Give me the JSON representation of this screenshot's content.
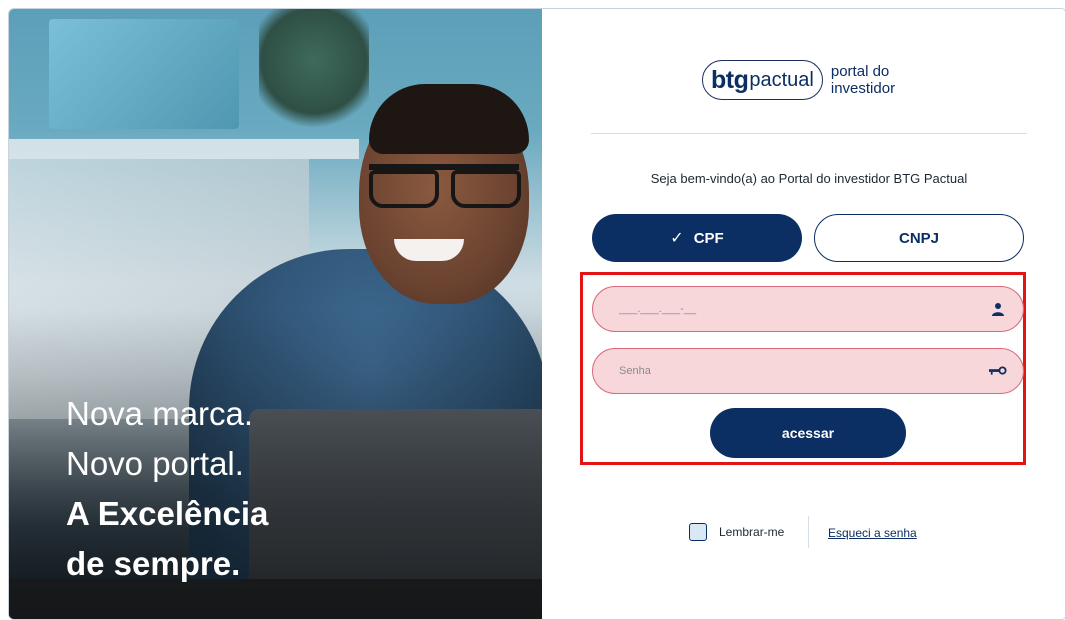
{
  "hero": {
    "tagline_line1": "Nova marca.",
    "tagline_line2": "Novo portal.",
    "tagline_line3": "A Excelência",
    "tagline_line4": "de sempre."
  },
  "logo": {
    "brand": "btg",
    "brand_suffix": "pactual",
    "subtitle_line1": "portal do",
    "subtitle_line2": "investidor"
  },
  "welcome_text": "Seja bem-vindo(a) ao Portal do investidor BTG Pactual",
  "doc_type_toggle": {
    "options": [
      "CPF",
      "CNPJ"
    ],
    "selected": "CPF",
    "check_glyph": "✓"
  },
  "login_form": {
    "cpf_placeholder": "___.___.___-__",
    "cpf_value": "",
    "password_placeholder": "Senha",
    "password_value": "",
    "cpf_icon": "user-icon",
    "password_icon": "key-icon",
    "submit_label": "acessar"
  },
  "remember_label": "Lembrar-me",
  "remember_checked": false,
  "forgot_label": "Esqueci a senha",
  "colors": {
    "brand_navy": "#0b2e63",
    "field_error_bg": "#f8d7da",
    "field_error_border": "#d96a7c",
    "highlight_red": "#e01414"
  }
}
